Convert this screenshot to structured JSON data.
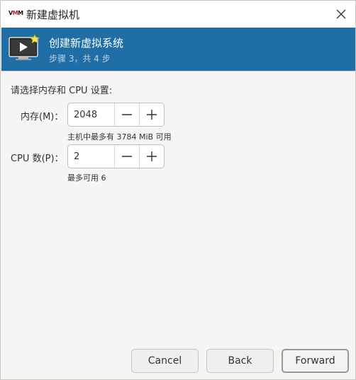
{
  "window": {
    "logo_v": "V",
    "logo_m": "M",
    "logo_rest": "M",
    "title": "新建虚拟机",
    "close_icon": "close-icon"
  },
  "banner": {
    "icon": "monitor-star-icon",
    "title": "创建新虚拟系统",
    "step": "步骤 3，共 4 步"
  },
  "form": {
    "prompt": "请选择内存和 CPU 设置:",
    "memory": {
      "label": "内存(M)：",
      "value": "2048",
      "hint": "主机中最多有 3784 MiB 可用",
      "decrement_icon": "minus-icon",
      "increment_icon": "plus-icon"
    },
    "cpu": {
      "label": "CPU 数(P)：",
      "value": "2",
      "hint": "最多可用 6",
      "decrement_icon": "minus-icon",
      "increment_icon": "plus-icon"
    }
  },
  "buttons": {
    "cancel": "Cancel",
    "back": "Back",
    "forward": "Forward"
  },
  "colors": {
    "banner": "#1f6fa6",
    "window_bg": "#f6f5f4"
  }
}
